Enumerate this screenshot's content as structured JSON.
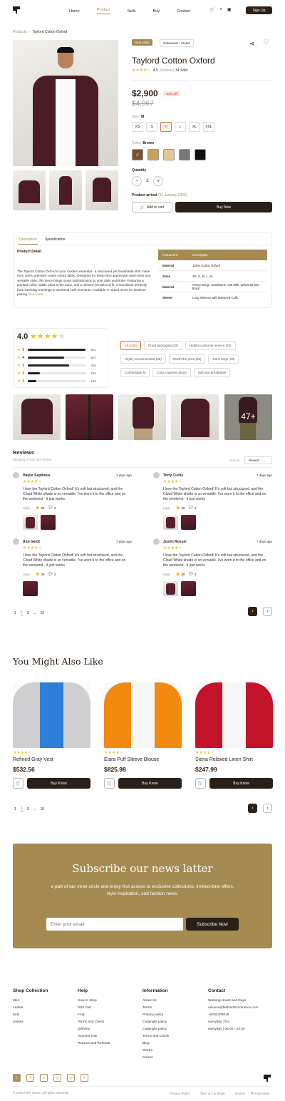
{
  "nav": {
    "items": [
      "Home",
      "Product",
      "Sells",
      "Buy",
      "Contact"
    ],
    "signup": "Sign Up"
  },
  "breadcrumb": {
    "parent": "Products",
    "sep": "›",
    "current": "Taylord Cotton Oxford"
  },
  "product": {
    "badge": "Best seller",
    "category": "Outerwear / Jacket",
    "title": "Taylord Cotton Oxford",
    "rating": "4.5",
    "reviews": "(reviews)",
    "sold": "34 Sold",
    "price": "$2,900",
    "discount": "-34% off",
    "old_price": "$4,067",
    "size_label": "Size:",
    "size_value": "M",
    "sizes": [
      "XS",
      "S",
      "M",
      "L",
      "XL",
      "XXL"
    ],
    "color_label": "Color:",
    "color_value": "Brown",
    "colors": [
      "#7a5230",
      "#c6a25b",
      "#e0c895",
      "#777777",
      "#111111"
    ],
    "qty_label": "Quantity",
    "qty": "2",
    "arrival_label": "Product arrival",
    "arrival_value": "(11 January 2025)",
    "add_cart": "Add to cart",
    "buy_now": "Buy Now"
  },
  "details": {
    "tabs": [
      "Description",
      "Spesification"
    ],
    "heading": "Product Detail",
    "text": "The Taylord Cotton Oxford is your modern essential - a structured yet breathable shirt made from 100% premium cotton oxford fabric. Designed for those who appreciate clean lines and versatile style, this piece brings smart sophistication to your daily wardrobe. Featuring a pointed collar, subtle pleat at the back, and a relaxed-yet-tailored fit, it transitions perfectly from weekday meetings to weekend café moments. Available in muted tones for timeless pairing.",
    "see_more": "See more",
    "table_head": [
      "Feauturerd",
      "Description"
    ],
    "table_rows": [
      [
        "Material",
        "100% Cotton Oxford"
      ],
      [
        "Sizes",
        "XS, S, M, L, XL"
      ],
      [
        "Material",
        "Honey Beige, Sandstone, Oat Milk, Wheat Brown, Black"
      ],
      [
        "Sleeve",
        "Long Sleeves with Buttoned Cuffs"
      ]
    ]
  },
  "ratings": {
    "score": "4.0",
    "rows": [
      {
        "star": "5",
        "count": "841",
        "fill": 0.98
      },
      {
        "star": "4",
        "count": "627",
        "fill": 0.62
      },
      {
        "star": "3",
        "count": "446",
        "fill": 0.7
      },
      {
        "star": "2",
        "count": "234",
        "fill": 0.2
      },
      {
        "star": "1",
        "count": "122",
        "fill": 0.14
      }
    ],
    "chips": [
      "All (180)",
      "Great packaging (32)",
      "Helpful customer service (43)",
      "Highly recommended (35)",
      "Worth the price (86)",
      "Runs large (28)",
      "Comfortable fit",
      "Color matches photo",
      "Soft and breathable"
    ],
    "more": "47+"
  },
  "reviews": {
    "title": "Reviews",
    "showing": "Showing 2 from 424 review",
    "sort_label": "Sort by:",
    "sort_value": "Newest",
    "items": [
      {
        "name": "Haylie Septimus",
        "time": "7 days ago",
        "text": "I love the Taylord Cotton Oxford! It's soft but structured, and the Cloud White shade is so versatile. I've worn it to the office and on the weekend - it just works",
        "reply": "reply",
        "likes": "39",
        "comments": "2"
      },
      {
        "name": "Terry Curtis",
        "time": "7 days ago",
        "text": "I love the Taylord Cotton Oxford! It's soft but structured, and the Cloud White shade is so versatile. I've worn it to the office and on the weekend - it just works",
        "reply": "reply",
        "likes": "39",
        "comments": "2"
      },
      {
        "name": "Ann Geidt",
        "time": "7 days ago",
        "text": "I love the Taylord Cotton Oxford! It's soft but structured, and the Cloud White shade is so versatile. I've worn it to the office and on the weekend - it just works",
        "reply": "reply",
        "likes": "39",
        "comments": "2"
      },
      {
        "name": "Justin Rosser",
        "time": "7 days ago",
        "text": "I love the Taylord Cotton Oxford! It's soft but structured, and the Cloud White shade is so versatile. I've worn it to the office and on the weekend - it just works",
        "reply": "reply",
        "likes": "39",
        "comments": "2"
      }
    ],
    "pages": [
      "1",
      "2",
      "3",
      "...",
      "10"
    ]
  },
  "also": {
    "title": "You Might Also Like",
    "cards": [
      {
        "name": "Refined Gray  Vest",
        "price": "$532.56",
        "color": "#cfcfd1",
        "inner": "#2f7fd8"
      },
      {
        "name": "Elara Puff Sleeve Blouse",
        "price": "$825.98",
        "color": "#f28a12",
        "inner": "#f6f6f6"
      },
      {
        "name": "Siena Relaxed Linen Shirt",
        "price": "$247.99",
        "color": "#c4142a",
        "inner": "#f6f6f6"
      }
    ],
    "buy": "Buy Know",
    "pages": [
      "1",
      "2",
      "3",
      "...",
      "10"
    ]
  },
  "subscribe": {
    "title": "Subscribe our news latter",
    "text": "e part of our inner circle and enjoy first access to exclusive collections, limited-time offers, style inspiration, and fashion news.",
    "placeholder": "Enter your email",
    "button": "Subscribe Now",
    "bg": "#a58b52"
  },
  "footer": {
    "cols": [
      {
        "title": "Shop Collection",
        "links": [
          "Men",
          "Ladies",
          "Kids",
          "Unisex"
        ]
      },
      {
        "title": "Help",
        "links": [
          "How to shop",
          "Size cart",
          "FAQ",
          "Terms and Check",
          "Delivery",
          "Voucher Use",
          "Returns and Refunds"
        ]
      },
      {
        "title": "Information",
        "links": [
          "About Us",
          "Terms",
          "Privacy policy",
          "Copyright policy",
          "Copyright policy",
          "Terms and Check",
          "Blog",
          "Stores",
          "Career"
        ]
      },
      {
        "title": "Contact",
        "links": [
          "Working Hours and Days",
          "veloura@fashionEccomerce.com",
          "+6782309019",
          "everyday 7/24",
          "everyday | 06:00 - 23:00"
        ]
      }
    ],
    "copyright": "© 2025 Fifth Street. All rights reserved",
    "links": [
      "Privacy Policy",
      "Term & Condition",
      "Cookie"
    ],
    "lang": "Indonesia"
  }
}
